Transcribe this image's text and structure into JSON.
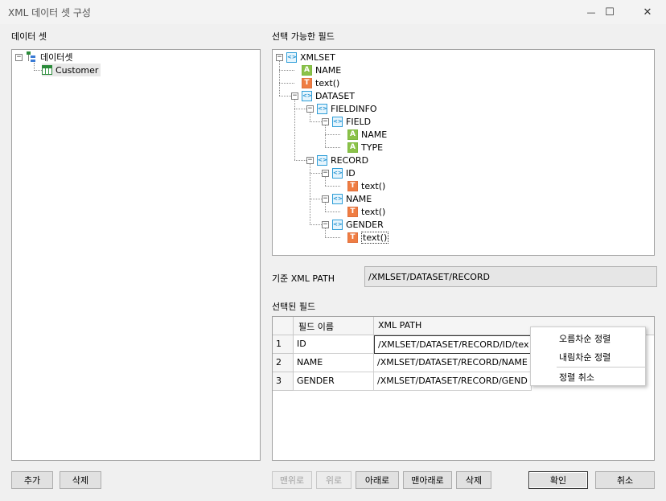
{
  "window": {
    "title": "XML 데이터 셋 구성",
    "minimize_glyph": "—",
    "maximize_glyph": "☐",
    "close_glyph": "✕"
  },
  "left": {
    "label": "데이터 셋",
    "tree": {
      "root": "데이터셋",
      "child": "Customer"
    }
  },
  "right": {
    "label": "선택 가능한 필드",
    "tree": [
      {
        "kind": "element",
        "text": "XMLSET"
      },
      {
        "kind": "attribute",
        "text": "NAME"
      },
      {
        "kind": "text",
        "text": "text()"
      },
      {
        "kind": "element",
        "text": "DATASET"
      },
      {
        "kind": "element",
        "text": "FIELDINFO"
      },
      {
        "kind": "element",
        "text": "FIELD"
      },
      {
        "kind": "attribute",
        "text": "NAME"
      },
      {
        "kind": "attribute",
        "text": "TYPE"
      },
      {
        "kind": "element",
        "text": "RECORD"
      },
      {
        "kind": "element",
        "text": "ID"
      },
      {
        "kind": "text",
        "text": "text()"
      },
      {
        "kind": "element",
        "text": "NAME"
      },
      {
        "kind": "text",
        "text": "text()"
      },
      {
        "kind": "element",
        "text": "GENDER"
      },
      {
        "kind": "text",
        "text": "text()"
      }
    ],
    "icon_glyphs": {
      "element": "<>",
      "attribute": "A",
      "text": "T"
    }
  },
  "xmlpath": {
    "label": "기준 XML PATH",
    "value": "/XMLSET/DATASET/RECORD"
  },
  "selected": {
    "label": "선택된 필드",
    "columns": [
      "필드 이름",
      "XML PATH"
    ],
    "rows": [
      {
        "num": "1",
        "name": "ID",
        "path": "/XMLSET/DATASET/RECORD/ID/tex"
      },
      {
        "num": "2",
        "name": "NAME",
        "path": "/XMLSET/DATASET/RECORD/NAME"
      },
      {
        "num": "3",
        "name": "GENDER",
        "path": "/XMLSET/DATASET/RECORD/GEND"
      }
    ]
  },
  "context_menu": {
    "items": [
      "오름차순 정렬",
      "내림차순 정렬",
      "정렬 취소"
    ]
  },
  "buttons": {
    "add": "추가",
    "delete_left": "삭제",
    "top": "맨위로",
    "up": "위로",
    "down": "아래로",
    "bottom": "맨아래로",
    "delete_right": "삭제",
    "ok": "확인",
    "cancel": "취소"
  },
  "colors": {
    "element_icon": "#1d8fd0",
    "attribute_icon": "#8cc24a",
    "text_icon": "#ef7d43"
  }
}
